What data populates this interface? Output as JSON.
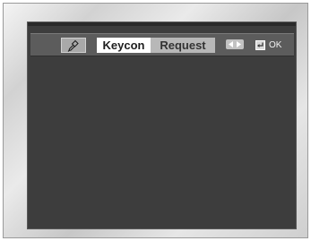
{
  "menu": {
    "mic_icon": "microphone-icon",
    "tabs": [
      {
        "label": "Keycon",
        "active": true
      },
      {
        "label": "Request",
        "active": false
      }
    ],
    "nav_hint_icon": "left-right-arrows-icon",
    "enter_icon": "enter-icon",
    "ok_label": "OK"
  },
  "colors": {
    "screen_bg": "#3d3d3d",
    "menu_bar": "#5c5c5c",
    "active_tab": "#ffffff",
    "inactive_tab": "#b8b8b8"
  }
}
